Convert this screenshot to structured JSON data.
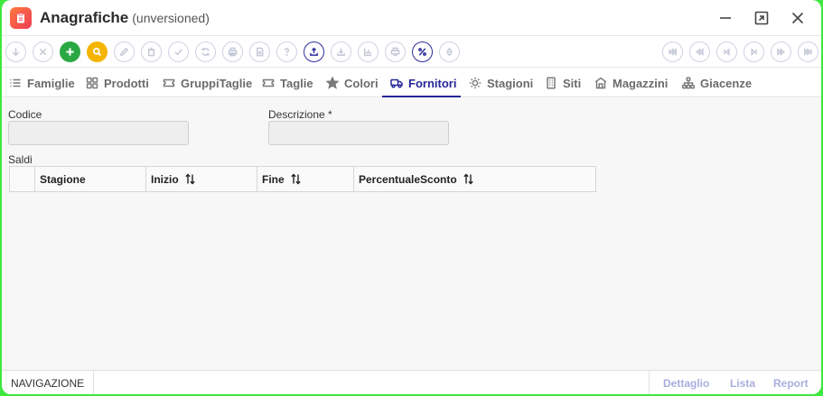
{
  "window": {
    "title": "Anagrafiche",
    "subtitle": "(unversioned)"
  },
  "toolbar": {
    "left_buttons": [
      {
        "name": "arrow-down-icon",
        "state": "disabled"
      },
      {
        "name": "close-icon",
        "state": "disabled"
      },
      {
        "name": "plus-icon",
        "state": "green"
      },
      {
        "name": "search-icon",
        "state": "yellow"
      },
      {
        "name": "pencil-icon",
        "state": "disabled"
      },
      {
        "name": "trash-icon",
        "state": "disabled"
      },
      {
        "name": "check-icon",
        "state": "disabled"
      },
      {
        "name": "refresh-icon",
        "state": "disabled"
      },
      {
        "name": "print-icon",
        "state": "disabled"
      },
      {
        "name": "document-icon",
        "state": "disabled"
      },
      {
        "name": "help-icon",
        "state": "disabled"
      },
      {
        "name": "upload-icon",
        "state": "active"
      },
      {
        "name": "download-icon",
        "state": "disabled"
      },
      {
        "name": "chart-icon",
        "state": "disabled"
      },
      {
        "name": "filter-icon",
        "state": "disabled"
      },
      {
        "name": "percent-icon",
        "state": "active"
      },
      {
        "name": "sort-icon",
        "state": "disabled"
      }
    ],
    "nav_buttons": [
      {
        "name": "first-page-icon"
      },
      {
        "name": "rewind-icon"
      },
      {
        "name": "previous-icon"
      },
      {
        "name": "next-icon"
      },
      {
        "name": "fast-forward-icon"
      },
      {
        "name": "last-page-icon"
      }
    ]
  },
  "tabs": [
    {
      "label": "Famiglie",
      "icon": "list-icon",
      "selected": false
    },
    {
      "label": "Prodotti",
      "icon": "grid-icon",
      "selected": false
    },
    {
      "label": "GruppiTaglie",
      "icon": "ticket-icon",
      "selected": false
    },
    {
      "label": "Taglie",
      "icon": "ticket-icon",
      "selected": false
    },
    {
      "label": "Colori",
      "icon": "star-icon",
      "selected": false
    },
    {
      "label": "Fornitori",
      "icon": "truck-icon",
      "selected": true
    },
    {
      "label": "Stagioni",
      "icon": "sun-icon",
      "selected": false
    },
    {
      "label": "Siti",
      "icon": "building-icon",
      "selected": false
    },
    {
      "label": "Magazzini",
      "icon": "warehouse-icon",
      "selected": false
    },
    {
      "label": "Giacenze",
      "icon": "hierarchy-icon",
      "selected": false
    }
  ],
  "form": {
    "codice_label": "Codice",
    "codice_value": "",
    "descrizione_label": "Descrizione *",
    "descrizione_value": "",
    "saldi_label": "Saldi"
  },
  "saldi_table": {
    "columns": [
      "Stagione",
      "Inizio",
      "Fine",
      "PercentualeSconto"
    ],
    "rows": []
  },
  "footer": {
    "navigation_label": "NAVIGAZIONE",
    "links": [
      "Dettaglio",
      "Lista",
      "Report"
    ]
  },
  "colors": {
    "accent": "#25259a",
    "add_button": "#2aa843",
    "search_button": "#f4b400",
    "footer_link": "#a9aede"
  }
}
